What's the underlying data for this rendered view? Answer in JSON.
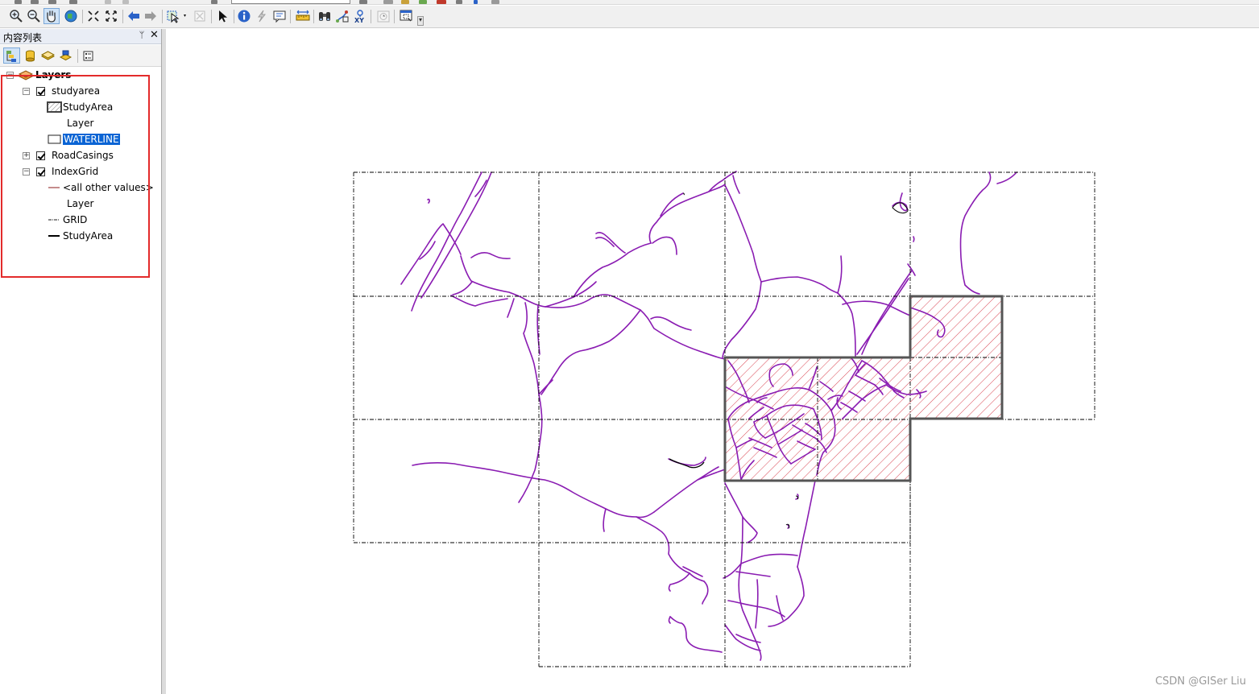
{
  "toc": {
    "title": "内容列表",
    "pin_glyph": "ᛘ",
    "close_glyph": "✕",
    "tree": {
      "root_label": "Layers",
      "studyarea_label": "studyarea",
      "studyarea_symbol_label": "StudyArea",
      "studyarea_symbol_label2": "Layer",
      "waterline_label": "WATERLINE",
      "roadcasings_label": "RoadCasings",
      "indexgrid_label": "IndexGrid",
      "all_other_values_label": "<all other values>",
      "indexgrid_field_label": "Layer",
      "grid_label": "GRID",
      "studyarea_line_label": "StudyArea"
    }
  },
  "expanders": {
    "minus": "−",
    "plus": "+"
  },
  "toolbar": {
    "more_glyph": "▾"
  },
  "colors": {
    "road": "#8a1cb2",
    "studyarea_border": "#555555",
    "studyarea_hatch": "#d94451",
    "grid_line": "#000000",
    "highlight": "#e32b2b",
    "selection": "#0a64d4",
    "grid_symbol": "#1a1a1a",
    "other_values_symbol": "#8b1a1a"
  },
  "watermark": "CSDN @GISer Liu"
}
